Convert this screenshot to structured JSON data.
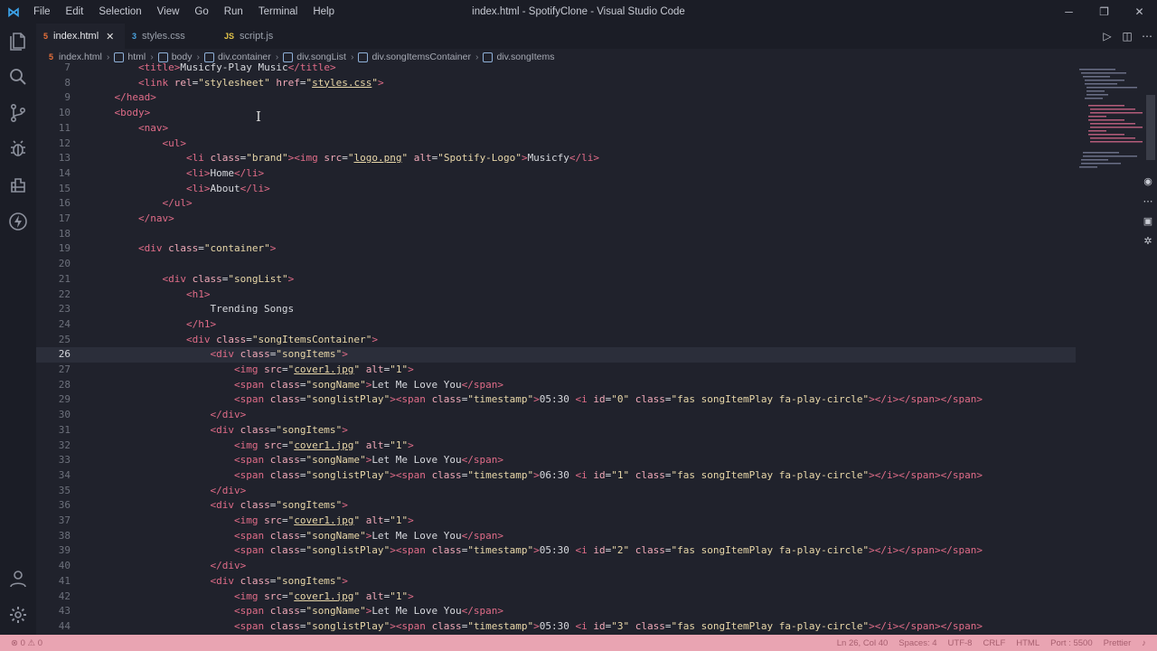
{
  "window": {
    "title": "index.html - SpotifyClone - Visual Studio Code"
  },
  "menu": [
    "File",
    "Edit",
    "Selection",
    "View",
    "Go",
    "Run",
    "Terminal",
    "Help"
  ],
  "tabs": [
    {
      "label": "index.html",
      "icon": "html-file-icon",
      "active": true
    },
    {
      "label": "styles.css",
      "icon": "css-file-icon",
      "active": false
    },
    {
      "label": "script.js",
      "icon": "js-file-icon",
      "active": false
    }
  ],
  "breadcrumb": [
    "index.html",
    "html",
    "body",
    "div.container",
    "div.songList",
    "div.songItemsContainer",
    "div.songItems"
  ],
  "code": {
    "active_line": 26,
    "lines": [
      {
        "n": "7",
        "t": "        <title>Musicfy-Play Music</title>"
      },
      {
        "n": "8",
        "t": "        <link rel=\"stylesheet\" href=\"styles.css\">"
      },
      {
        "n": "9",
        "t": "    </head>"
      },
      {
        "n": "10",
        "t": "    <body>"
      },
      {
        "n": "11",
        "t": "        <nav>"
      },
      {
        "n": "12",
        "t": "            <ul>"
      },
      {
        "n": "13",
        "t": "                <li class=\"brand\"><img src=\"logo.png\" alt=\"Spotify-Logo\">Musicfy</li>"
      },
      {
        "n": "14",
        "t": "                <li>Home</li>"
      },
      {
        "n": "15",
        "t": "                <li>About</li>"
      },
      {
        "n": "16",
        "t": "            </ul>"
      },
      {
        "n": "17",
        "t": "        </nav>"
      },
      {
        "n": "18",
        "t": ""
      },
      {
        "n": "19",
        "t": "        <div class=\"container\">"
      },
      {
        "n": "20",
        "t": ""
      },
      {
        "n": "21",
        "t": "            <div class=\"songList\">"
      },
      {
        "n": "22",
        "t": "                <h1>"
      },
      {
        "n": "23",
        "t": "                    Trending Songs"
      },
      {
        "n": "24",
        "t": "                </h1>"
      },
      {
        "n": "25",
        "t": "                <div class=\"songItemsContainer\">"
      },
      {
        "n": "26",
        "t": "                    <div class=\"songItems\">"
      },
      {
        "n": "27",
        "t": "                        <img src=\"cover1.jpg\" alt=\"1\">"
      },
      {
        "n": "28",
        "t": "                        <span class=\"songName\">Let Me Love You</span>"
      },
      {
        "n": "29",
        "t": "                        <span class=\"songlistPlay\"><span class=\"timestamp\">05:30 <i id=\"0\" class=\"fas songItemPlay fa-play-circle\"></i></span></span>"
      },
      {
        "n": "30",
        "t": "                    </div>"
      },
      {
        "n": "31",
        "t": "                    <div class=\"songItems\">"
      },
      {
        "n": "32",
        "t": "                        <img src=\"cover1.jpg\" alt=\"1\">"
      },
      {
        "n": "33",
        "t": "                        <span class=\"songName\">Let Me Love You</span>"
      },
      {
        "n": "34",
        "t": "                        <span class=\"songlistPlay\"><span class=\"timestamp\">06:30 <i id=\"1\" class=\"fas songItemPlay fa-play-circle\"></i></span></span>"
      },
      {
        "n": "35",
        "t": "                    </div>"
      },
      {
        "n": "36",
        "t": "                    <div class=\"songItems\">"
      },
      {
        "n": "37",
        "t": "                        <img src=\"cover1.jpg\" alt=\"1\">"
      },
      {
        "n": "38",
        "t": "                        <span class=\"songName\">Let Me Love You</span>"
      },
      {
        "n": "39",
        "t": "                        <span class=\"songlistPlay\"><span class=\"timestamp\">05:30 <i id=\"2\" class=\"fas songItemPlay fa-play-circle\"></i></span></span>"
      },
      {
        "n": "40",
        "t": "                    </div>"
      },
      {
        "n": "41",
        "t": "                    <div class=\"songItems\">"
      },
      {
        "n": "42",
        "t": "                        <img src=\"cover1.jpg\" alt=\"1\">"
      },
      {
        "n": "43",
        "t": "                        <span class=\"songName\">Let Me Love You</span>"
      },
      {
        "n": "44",
        "t": "                        <span class=\"songlistPlay\"><span class=\"timestamp\">05:30 <i id=\"3\" class=\"fas songItemPlay fa-play-circle\"></i></span></span>"
      }
    ]
  },
  "status": {
    "errors": "0",
    "warnings": "0",
    "position": "Ln 26, Col 40",
    "spaces": "Spaces: 4",
    "encoding": "UTF-8",
    "eol": "CRLF",
    "language": "HTML",
    "port": "Port : 5500",
    "prettier": "Prettier"
  },
  "colors": {
    "tag": "#e06c88",
    "attr": "#f0a9b8",
    "string": "#e8d7a8",
    "statusbar": "#e9a4b2"
  }
}
